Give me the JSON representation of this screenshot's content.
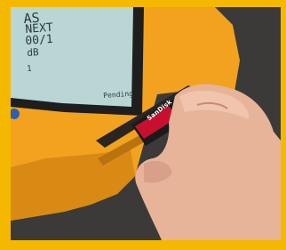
{
  "image": {
    "subject": "A hand inserting a memory card into the slot of a yellow handheld device with an LCD screen"
  },
  "screen": {
    "line1": "AS",
    "line2": "NEXT",
    "line3": "00/1",
    "line4": "dB",
    "line5": "1",
    "line6": "Pending"
  },
  "card": {
    "brand": "SanDisk"
  },
  "colors": {
    "border": "#f5b800",
    "device_yellow": "#f2a21e",
    "lcd": "#b9d6d4",
    "skin": "#e7b49a",
    "card_red": "#c8102e"
  }
}
